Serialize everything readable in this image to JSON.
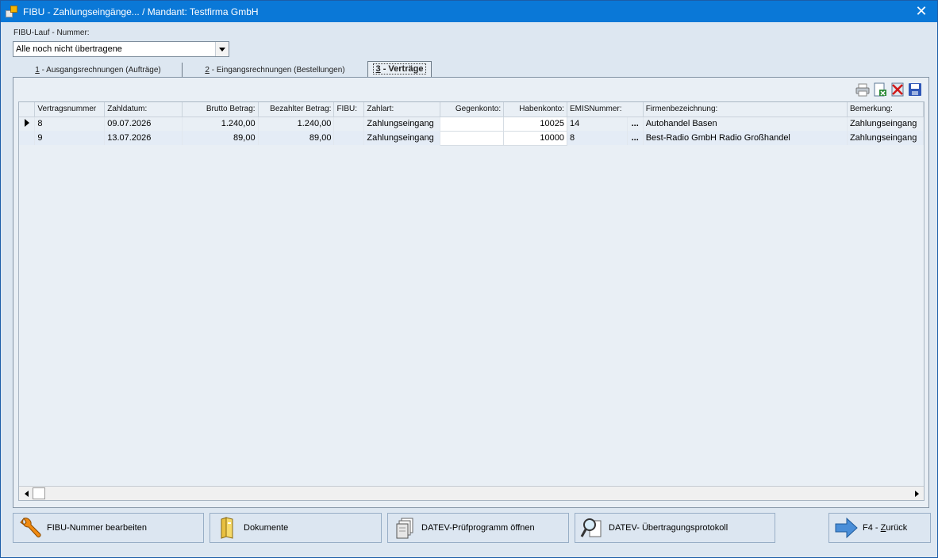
{
  "window": {
    "title": "FIBU - Zahlungseingänge... / Mandant: Testfirma GmbH",
    "close_glyph": "✕"
  },
  "filter": {
    "label": "FIBU-Lauf - Nummer:",
    "selected": "Alle noch nicht übertragene"
  },
  "tabs": [
    {
      "key": "1",
      "label": " - Ausgangsrechnungen (Aufträge)"
    },
    {
      "key": "2",
      "label": " - Eingangsrechnungen (Bestellungen)"
    },
    {
      "key": "3",
      "label": " - Verträge"
    }
  ],
  "toolbar": {
    "icons": [
      "printer-icon",
      "export-excel-icon",
      "delete-icon",
      "save-icon"
    ]
  },
  "grid": {
    "columns": [
      "Vertragsnummer",
      "Zahldatum:",
      "Brutto Betrag:",
      "Bezahlter Betrag:",
      "FIBU:",
      "Zahlart:",
      "Gegenkonto:",
      "Habenkonto:",
      "EMISNummer:",
      "Firmenbezeichnung:",
      "Bemerkung:"
    ],
    "rows": [
      {
        "vertragsnummer": "8",
        "zahldatum": "09.07.2026",
        "brutto": "1.240,00",
        "bezahlt": "1.240,00",
        "fibu": "",
        "zahlart": "Zahlungseingang",
        "gegenkonto": "",
        "habenkonto": "10025",
        "emis": "14",
        "emis_btn": "...",
        "firma": "Autohandel Basen",
        "bemerkung": "Zahlungseingang"
      },
      {
        "vertragsnummer": "9",
        "zahldatum": "13.07.2026",
        "brutto": "89,00",
        "bezahlt": "89,00",
        "fibu": "",
        "zahlart": "Zahlungseingang",
        "gegenkonto": "",
        "habenkonto": "10000",
        "emis": "8",
        "emis_btn": "...",
        "firma": "Best-Radio GmbH Radio Großhandel",
        "bemerkung": "Zahlungseingang"
      }
    ]
  },
  "buttons": {
    "fibu_edit": "FIBU-Nummer bearbeiten",
    "dokumente": "Dokumente",
    "datev_pruef": "DATEV-Prüfprogramm öffnen",
    "datev_protokoll": "DATEV- Übertragungsprotokoll",
    "back_prefix": "F4 - ",
    "back_key": "Z",
    "back_rest": "urück"
  },
  "colors": {
    "titlebar": "#0a78d7",
    "window_bg": "#dde7f1",
    "grid_bg": "#e9eff5"
  }
}
